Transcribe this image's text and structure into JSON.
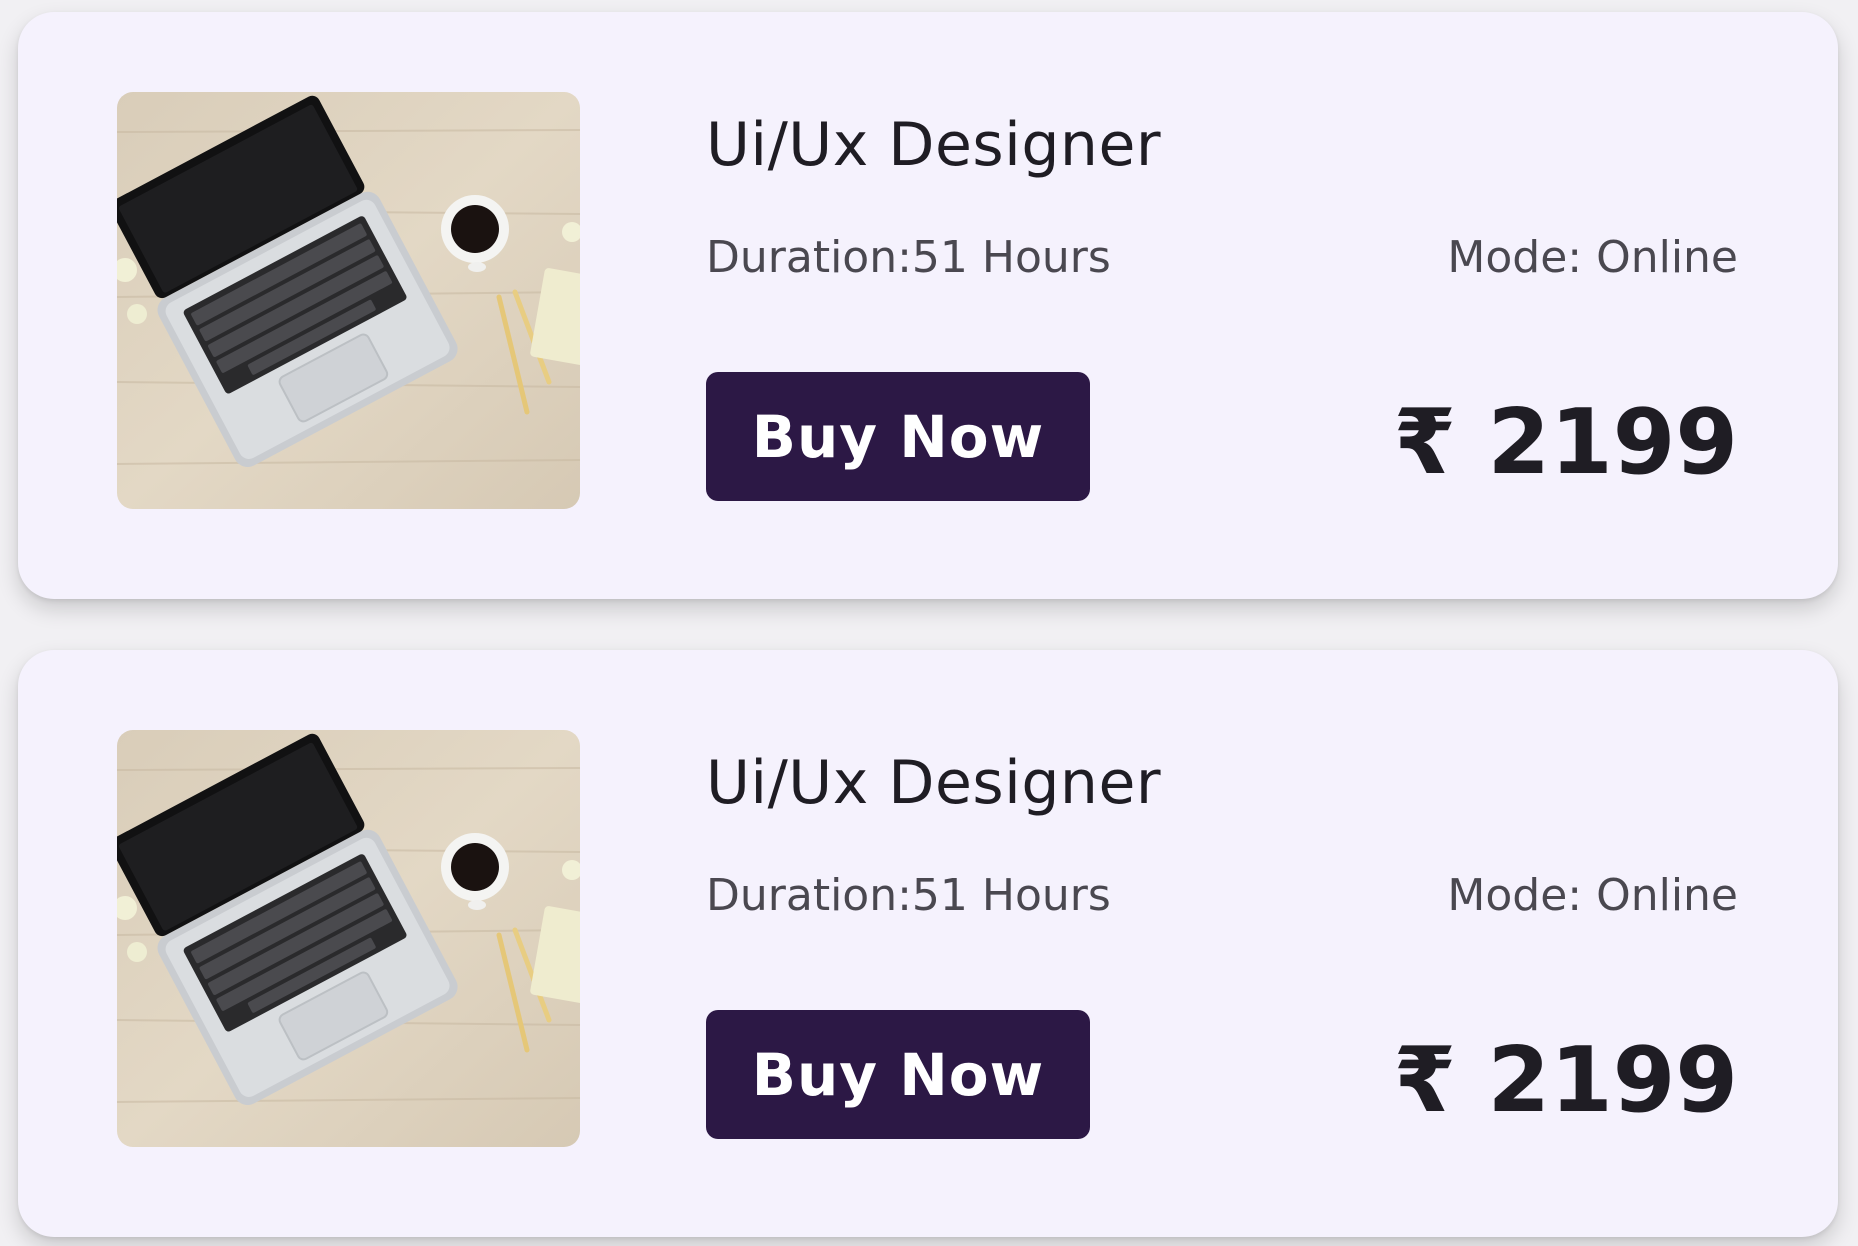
{
  "courses": [
    {
      "title": "Ui/Ux Designer",
      "duration": "Duration:51 Hours",
      "mode": "Mode: Online",
      "buy_label": "Buy Now",
      "price": "₹ 2199",
      "image_icon": "laptop-desk-photo"
    },
    {
      "title": "Ui/Ux Designer",
      "duration": "Duration:51 Hours",
      "mode": "Mode: Online",
      "buy_label": "Buy Now",
      "price": "₹ 2199",
      "image_icon": "laptop-desk-photo"
    }
  ],
  "colors": {
    "card_background": "#f5f2fd",
    "button_background": "#2c1845",
    "button_text": "#ffffff",
    "title_text": "#1f1d24",
    "meta_text": "#4a4850"
  }
}
